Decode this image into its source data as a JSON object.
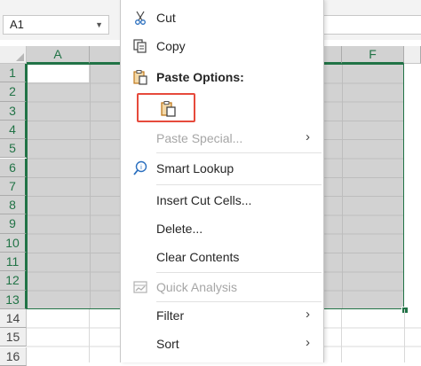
{
  "formula_bar": {
    "name_box": "A1"
  },
  "grid": {
    "columns": [
      "A",
      "F"
    ],
    "rows": [
      "1",
      "2",
      "3",
      "4",
      "5",
      "6",
      "7",
      "8",
      "9",
      "10",
      "11",
      "12",
      "13",
      "14",
      "15",
      "16"
    ]
  },
  "context_menu": {
    "items": [
      {
        "label": "Cut",
        "icon": "scissors-icon"
      },
      {
        "label": "Copy",
        "icon": "copy-icon"
      },
      {
        "label": "Paste Options:",
        "icon": "clipboard-icon"
      },
      {
        "label": "Paste Special...",
        "disabled": true
      },
      {
        "label": "Smart Lookup",
        "icon": "smart-lookup-icon"
      },
      {
        "label": "Insert Cut Cells..."
      },
      {
        "label": "Delete..."
      },
      {
        "label": "Clear Contents"
      },
      {
        "label": "Quick Analysis",
        "icon": "quick-analysis-icon",
        "disabled": true
      },
      {
        "label": "Filter"
      },
      {
        "label": "Sort"
      }
    ],
    "submenu_arrow": "›"
  },
  "colors": {
    "accent_green": "#217346",
    "highlight_red": "#e64a3c",
    "selection_gray": "#d2d2d2"
  }
}
